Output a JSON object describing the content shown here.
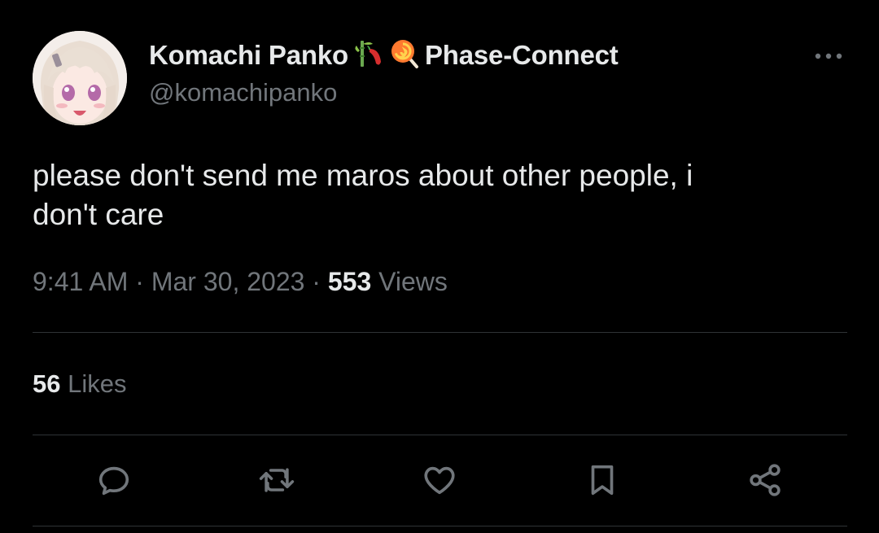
{
  "tweet": {
    "author": {
      "display_name": "Komachi Panko",
      "emojis": [
        "bamboo-chili-icon",
        "lollipop-icon"
      ],
      "affiliation": "Phase-Connect",
      "handle": "@komachipanko"
    },
    "text": "please don't send me maros about other people, i\ndon't care",
    "meta": {
      "time": "9:41 AM",
      "separator": "·",
      "date": "Mar 30, 2023",
      "views_count": "553",
      "views_label": "Views"
    },
    "engagement": {
      "likes_count": "56",
      "likes_label": "Likes"
    },
    "actions": [
      "reply-icon",
      "retweet-icon",
      "like-icon",
      "bookmark-icon",
      "share-icon"
    ]
  },
  "colors": {
    "background": "#000000",
    "primary_text": "#e7e9ea",
    "secondary_text": "#71767b",
    "divider": "#2f3336"
  }
}
